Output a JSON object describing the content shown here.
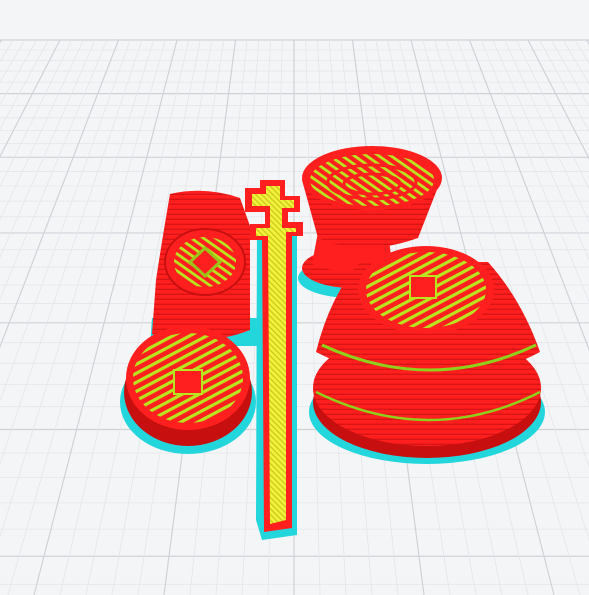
{
  "viewport": {
    "background_color": "#f4f5f7",
    "grid_major_color": "#cfd3d8",
    "grid_minor_color": "#e3e6ea"
  },
  "toolpath_colors": {
    "wall_outer": "#ff1f1f",
    "wall_shadow": "#c80f0f",
    "infill": "#b9e61e",
    "top_skin": "#f2f23a",
    "skirt": "#23d6dc",
    "inner_wall": "#8fd11a"
  },
  "objects": [
    {
      "name": "square-hole-coin-upright",
      "visible": true
    },
    {
      "name": "square-hole-coin-flat",
      "visible": true
    },
    {
      "name": "long-cross-stick",
      "visible": true
    },
    {
      "name": "bowl-on-pedestal",
      "visible": true
    },
    {
      "name": "domed-base-with-square-hole",
      "visible": true
    }
  ]
}
